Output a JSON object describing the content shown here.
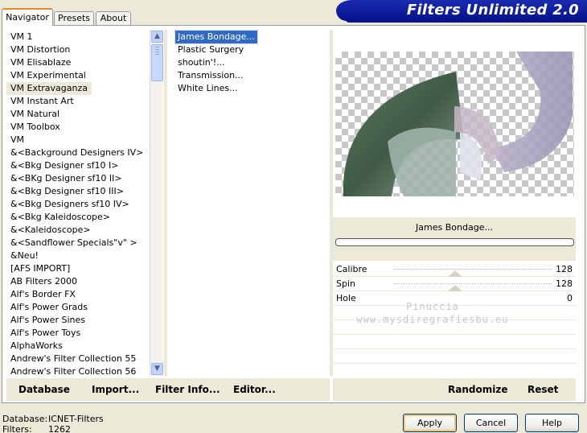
{
  "tabs": [
    {
      "label": "Navigator",
      "active": true
    },
    {
      "label": "Presets",
      "active": false
    },
    {
      "label": "About",
      "active": false
    }
  ],
  "banner_title": "Filters Unlimited 2.0",
  "categories": [
    "VM 1",
    "VM Distortion",
    "VM Elisablaze",
    "VM Experimental",
    "VM Extravaganza",
    "VM Instant Art",
    "VM Natural",
    "VM Toolbox",
    "VM",
    "&<Background Designers IV>",
    "&<Bkg Designer sf10 I>",
    "&<BKg Designer sf10 II>",
    "&<Bkg Designer sf10 III>",
    "&<Bkg Designers sf10 IV>",
    "&<Bkg Kaleidoscope>",
    "&<Kaleidoscope>",
    "&<Sandflower Specials\"v\" >",
    "&Neu!",
    "[AFS IMPORT]",
    "AB Filters 2000",
    "Alf's Border FX",
    "Alf's Power Grads",
    "Alf's Power Sines",
    "Alf's Power Toys",
    "AlphaWorks",
    "Andrew's Filter Collection 55",
    "Andrew's Filter Collection 56"
  ],
  "selected_category_index": 4,
  "effects": [
    "James Bondage...",
    "Plastic Surgery",
    "shoutin'!...",
    "Transmission...",
    "White Lines..."
  ],
  "selected_effect_index": 0,
  "current_filter": "James Bondage...",
  "params": [
    {
      "label": "Calibre",
      "value": "128"
    },
    {
      "label": "Spin",
      "value": "128"
    },
    {
      "label": "Hole",
      "value": "0"
    }
  ],
  "watermark": {
    "line1": "Pinuccia",
    "line2": "www.mysdiregrafiesbu.eu"
  },
  "toolbar_left": {
    "database": "Database",
    "import": "Import...",
    "filter_info": "Filter Info...",
    "editor": "Editor..."
  },
  "toolbar_right": {
    "randomize": "Randomize",
    "reset": "Reset"
  },
  "status": {
    "database_label": "Database:",
    "database_value": "ICNET-Filters",
    "filters_label": "Filters:",
    "filters_value": "1262"
  },
  "buttons": {
    "apply": "Apply",
    "cancel": "Cancel",
    "help": "Help"
  }
}
